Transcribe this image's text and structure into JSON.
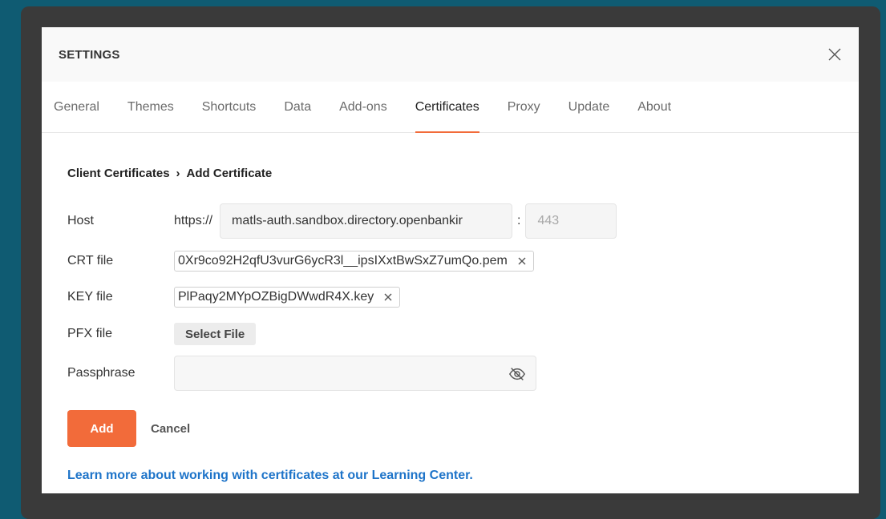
{
  "dialog": {
    "title": "SETTINGS"
  },
  "tabs": [
    {
      "label": "General"
    },
    {
      "label": "Themes"
    },
    {
      "label": "Shortcuts"
    },
    {
      "label": "Data"
    },
    {
      "label": "Add-ons"
    },
    {
      "label": "Certificates",
      "active": true
    },
    {
      "label": "Proxy"
    },
    {
      "label": "Update"
    },
    {
      "label": "About"
    }
  ],
  "breadcrumb": {
    "parent": "Client Certificates",
    "separator": "›",
    "current": "Add Certificate"
  },
  "form": {
    "host_label": "Host",
    "host_prefix": "https://",
    "host_value": "matls-auth.sandbox.directory.openbankir",
    "port_separator": ":",
    "port_placeholder": "443",
    "crt_label": "CRT file",
    "crt_value": "0Xr9co92H2qfU3vurG6ycR3l__ipsIXxtBwSxZ7umQo.pem",
    "key_label": "KEY file",
    "key_value": "PlPaqy2MYpOZBigDWwdR4X.key",
    "pfx_label": "PFX file",
    "pfx_button": "Select File",
    "pass_label": "Passphrase",
    "pass_value": ""
  },
  "actions": {
    "add": "Add",
    "cancel": "Cancel"
  },
  "footer": {
    "link": "Learn more about working with certificates at our Learning Center."
  },
  "colors": {
    "accent": "#f26b3a",
    "link": "#1e74c9",
    "background": "#0f5b72"
  }
}
